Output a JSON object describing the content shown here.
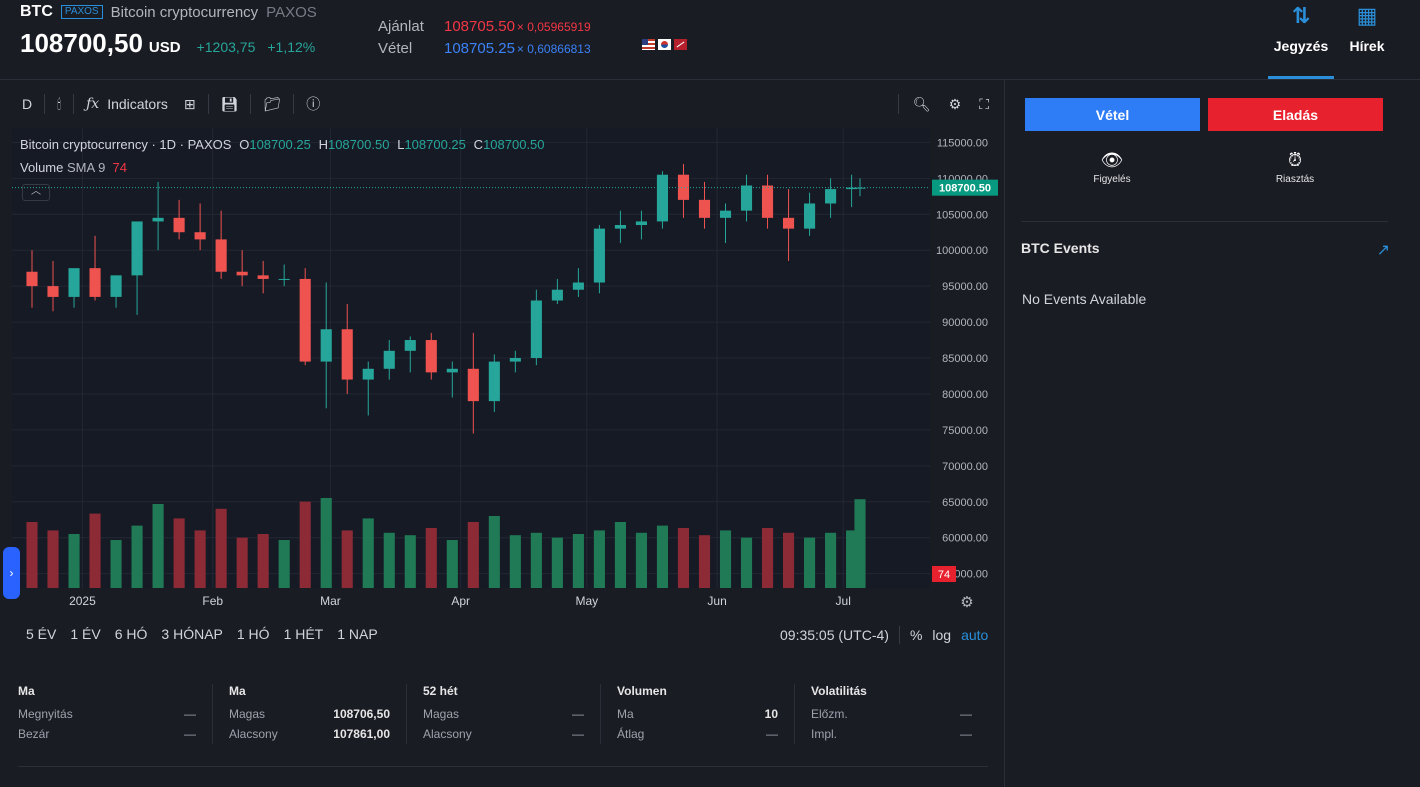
{
  "header": {
    "ticker": "BTC",
    "exchange_badge": "PAXOS",
    "name": "Bitcoin cryptocurrency",
    "exchange": "PAXOS",
    "last_price": "108700,50",
    "currency": "USD",
    "change": "+1203,75",
    "change_pct": "+1,12%",
    "ask_label": "Ajánlat",
    "ask_price": "108705.50",
    "ask_size": "× 0,05965919",
    "bid_label": "Vétel",
    "bid_price": "108705.25",
    "bid_size": "× 0,60866813",
    "tabs": [
      {
        "label": "Jegyzés",
        "icon": "sort-arrows-icon",
        "active": true
      },
      {
        "label": "Hírek",
        "icon": "news-icon",
        "active": false
      }
    ]
  },
  "toolbar": {
    "interval": "D",
    "indicators_label": "Indicators"
  },
  "legend": {
    "title": "Bitcoin cryptocurrency · 1D · PAXOS",
    "o_label": "O",
    "o_val": "108700.25",
    "h_label": "H",
    "h_val": "108700.50",
    "l_label": "L",
    "l_val": "108700.25",
    "c_label": "C",
    "c_val": "108700.50",
    "volume_label": "Volume",
    "sma_label": "SMA 9",
    "volume_value": "74"
  },
  "chart_data": {
    "type": "candlestick",
    "price_axis": [
      "115000.00",
      "110000.00",
      "105000.00",
      "100000.00",
      "95000.00",
      "90000.00",
      "85000.00",
      "80000.00",
      "75000.00",
      "70000.00",
      "65000.00",
      "60000.00",
      "55000.00"
    ],
    "last_price_tag": "108700.50",
    "volume_tag": "74",
    "time_axis": [
      "2025",
      "Feb",
      "Mar",
      "Apr",
      "May",
      "Jun",
      "Jul"
    ],
    "ylim": [
      53000,
      117000
    ],
    "colors": {
      "up": "#26a69a",
      "down": "#ef5350",
      "up_vol": "#1f7a55",
      "down_vol": "#8c2a35"
    },
    "x": [
      "2024-12-20",
      "2024-12-25",
      "2024-12-30",
      "2025-01-04",
      "2025-01-09",
      "2025-01-14",
      "2025-01-19",
      "2025-01-24",
      "2025-01-29",
      "2025-02-03",
      "2025-02-08",
      "2025-02-13",
      "2025-02-18",
      "2025-02-23",
      "2025-02-28",
      "2025-03-05",
      "2025-03-10",
      "2025-03-15",
      "2025-03-20",
      "2025-03-25",
      "2025-03-30",
      "2025-04-04",
      "2025-04-09",
      "2025-04-14",
      "2025-04-19",
      "2025-04-24",
      "2025-04-29",
      "2025-05-04",
      "2025-05-09",
      "2025-05-14",
      "2025-05-19",
      "2025-05-24",
      "2025-05-29",
      "2025-06-03",
      "2025-06-08",
      "2025-06-13",
      "2025-06-18",
      "2025-06-23",
      "2025-06-28",
      "2025-07-03",
      "2025-07-05"
    ],
    "series": [
      {
        "name": "Price",
        "open": [
          97000,
          95000,
          93500,
          97500,
          93500,
          96500,
          104000,
          104500,
          102500,
          101500,
          97000,
          96500,
          96000,
          96000,
          84500,
          89000,
          82000,
          83500,
          86000,
          87500,
          83000,
          83500,
          79000,
          84500,
          85000,
          93000,
          94500,
          95500,
          103000,
          103500,
          104000,
          110500,
          107000,
          104500,
          105500,
          109000,
          104500,
          103000,
          106500,
          108500,
          108700
        ],
        "high": [
          100000,
          98500,
          96000,
          102000,
          96500,
          101000,
          109500,
          107000,
          106500,
          105500,
          100000,
          98500,
          98000,
          97500,
          95500,
          92500,
          84500,
          87500,
          88000,
          88500,
          84500,
          88500,
          85500,
          86000,
          94500,
          96000,
          97500,
          103500,
          105500,
          105500,
          111000,
          112000,
          109500,
          106500,
          110500,
          110500,
          108500,
          108000,
          110000,
          110500,
          110000
        ],
        "low": [
          92000,
          91500,
          92000,
          93000,
          92000,
          91000,
          100000,
          101500,
          100000,
          96000,
          95000,
          94000,
          95000,
          84000,
          78000,
          80000,
          77000,
          82000,
          83000,
          82000,
          79500,
          74500,
          77500,
          83000,
          84000,
          92500,
          93500,
          94000,
          101000,
          101500,
          103000,
          104500,
          103000,
          101000,
          104000,
          103000,
          98500,
          102000,
          104500,
          106000,
          107500
        ],
        "close": [
          95000,
          93500,
          97500,
          93500,
          96500,
          104000,
          104500,
          102500,
          101500,
          97000,
          96500,
          96000,
          96000,
          84500,
          89000,
          82000,
          83500,
          86000,
          87500,
          83000,
          83500,
          79000,
          84500,
          85000,
          93000,
          94500,
          95500,
          103000,
          103500,
          104000,
          110500,
          107000,
          104500,
          105500,
          109000,
          104500,
          103000,
          106500,
          108500,
          108700,
          108700
        ]
      },
      {
        "name": "Volume",
        "values": [
          55,
          48,
          45,
          62,
          40,
          52,
          70,
          58,
          48,
          66,
          42,
          45,
          40,
          72,
          75,
          48,
          58,
          46,
          44,
          50,
          40,
          55,
          60,
          44,
          46,
          42,
          45,
          48,
          55,
          46,
          52,
          50,
          44,
          48,
          42,
          50,
          46,
          42,
          46,
          48,
          74
        ]
      }
    ]
  },
  "ranges": [
    "5 ÉV",
    "1 ÉV",
    "6 HÓ",
    "3 HÓNAP",
    "1 HÓ",
    "1 HÉT",
    "1 NAP"
  ],
  "status": {
    "time": "09:35:05 (UTC-4)",
    "pct": "%",
    "log": "log",
    "auto": "auto"
  },
  "stats": [
    {
      "title": "Ma",
      "rows": [
        {
          "k": "Megnyitás",
          "v": "—"
        },
        {
          "k": "Bezár",
          "v": "—"
        }
      ]
    },
    {
      "title": "Ma",
      "rows": [
        {
          "k": "Magas",
          "v": "108706,50"
        },
        {
          "k": "Alacsony",
          "v": "107861,00"
        }
      ]
    },
    {
      "title": "52 hét",
      "rows": [
        {
          "k": "Magas",
          "v": "—"
        },
        {
          "k": "Alacsony",
          "v": "—"
        }
      ]
    },
    {
      "title": "Volumen",
      "rows": [
        {
          "k": "Ma",
          "v": "10"
        },
        {
          "k": "Átlag",
          "v": "—"
        }
      ]
    },
    {
      "title": "Volatilitás",
      "rows": [
        {
          "k": "Előzm.",
          "v": "—"
        },
        {
          "k": "Impl.",
          "v": "—"
        }
      ]
    }
  ],
  "panel": {
    "buy_label": "Vétel",
    "sell_label": "Eladás",
    "watch_label": "Figyelés",
    "alert_label": "Riasztás",
    "events_title": "BTC Events",
    "events_empty": "No Events Available"
  }
}
